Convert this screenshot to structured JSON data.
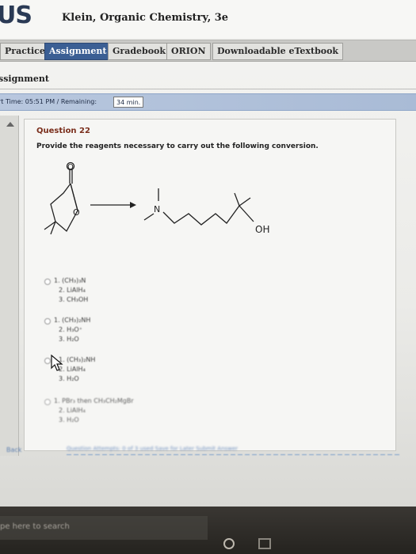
{
  "header": {
    "logo": "US",
    "book_title": "Klein, Organic Chemistry, 3e"
  },
  "nav": {
    "items": [
      {
        "label": "Practice"
      },
      {
        "label": "Assignment",
        "active": true
      },
      {
        "label": "Gradebook"
      },
      {
        "label": "ORION"
      },
      {
        "label": "Downloadable eTextbook"
      }
    ]
  },
  "section": {
    "label": "ssignment"
  },
  "timer": {
    "text": "rt Time: 05:51 PM / Remaining:",
    "remaining": "34 min."
  },
  "question": {
    "title": "Question 22",
    "prompt": "Provide the reagents necessary to carry out the following conversion.",
    "product_label": "OH",
    "nitrogen_label": "N"
  },
  "options": [
    {
      "steps": [
        "1. (CH₃)₃N",
        "2. LiAlH₄",
        "3. CH₃OH"
      ]
    },
    {
      "steps": [
        "1. (CH₃)₂NH",
        "2. H₃O⁺",
        "3. H₂O"
      ]
    },
    {
      "steps": [
        "1. (CH₃)₂NH",
        "2. LiAlH₄",
        "3. H₂O"
      ]
    },
    {
      "steps": [
        "1. PBr₃ then CH₃CH₂MgBr",
        "2. LiAlH₄",
        "3. H₂O"
      ]
    }
  ],
  "footer": {
    "link": "Back",
    "text": "Question Attempts: 0 of 3 used   Save for Later   Submit Answer"
  },
  "taskbar": {
    "search_placeholder": "pe here to search"
  },
  "colors": {
    "accent": "#3b5f94",
    "title": "#7a2e1c"
  }
}
